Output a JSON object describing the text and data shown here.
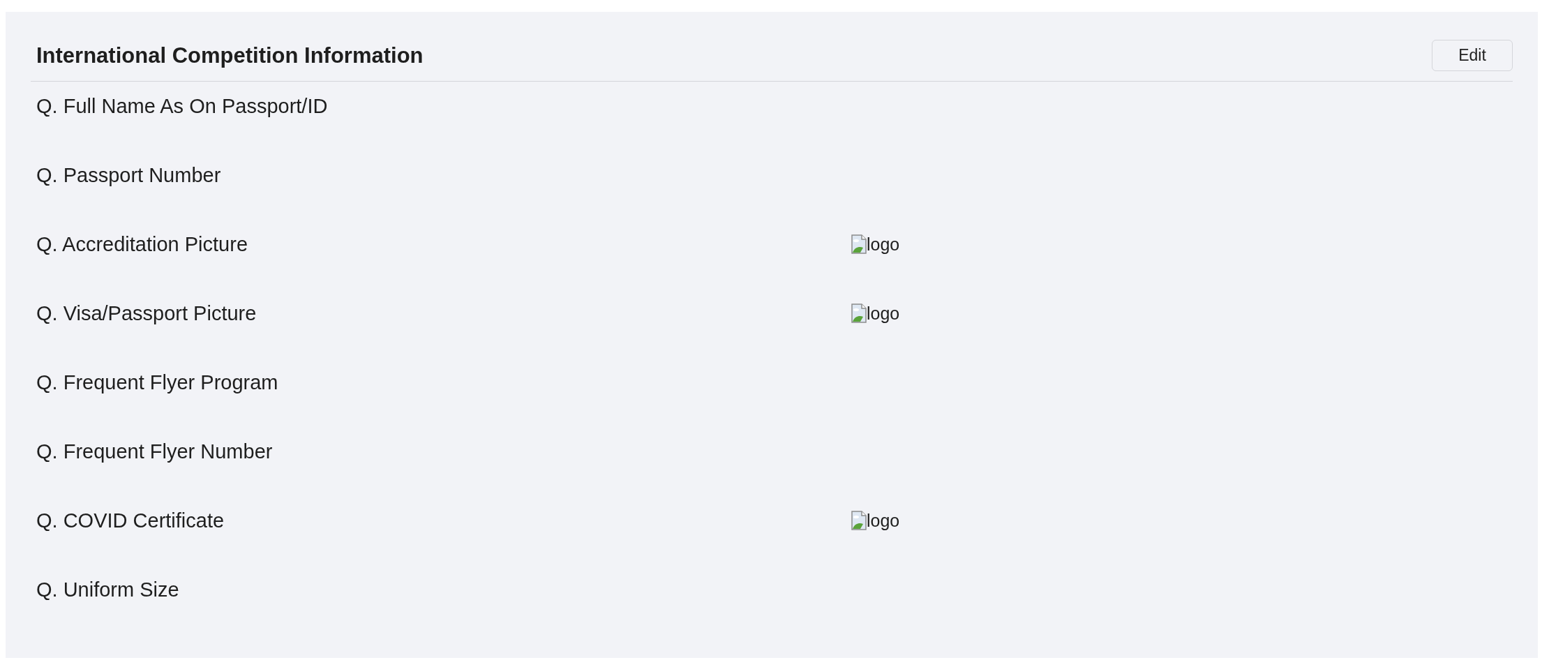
{
  "section": {
    "title": "International Competition Information",
    "edit_button": "Edit"
  },
  "questions": [
    {
      "label": "Q. Full Name As On Passport/ID"
    },
    {
      "label": "Q. Passport Number"
    },
    {
      "label": "Q. Accreditation Picture",
      "answer": {
        "kind": "image",
        "alt": "logo"
      }
    },
    {
      "label": "Q. Visa/Passport Picture",
      "answer": {
        "kind": "image",
        "alt": "logo"
      }
    },
    {
      "label": "Q. Frequent Flyer Program"
    },
    {
      "label": "Q. Frequent Flyer Number"
    },
    {
      "label": "Q. COVID Certificate",
      "answer": {
        "kind": "image",
        "alt": "logo"
      }
    },
    {
      "label": "Q. Uniform Size"
    }
  ]
}
